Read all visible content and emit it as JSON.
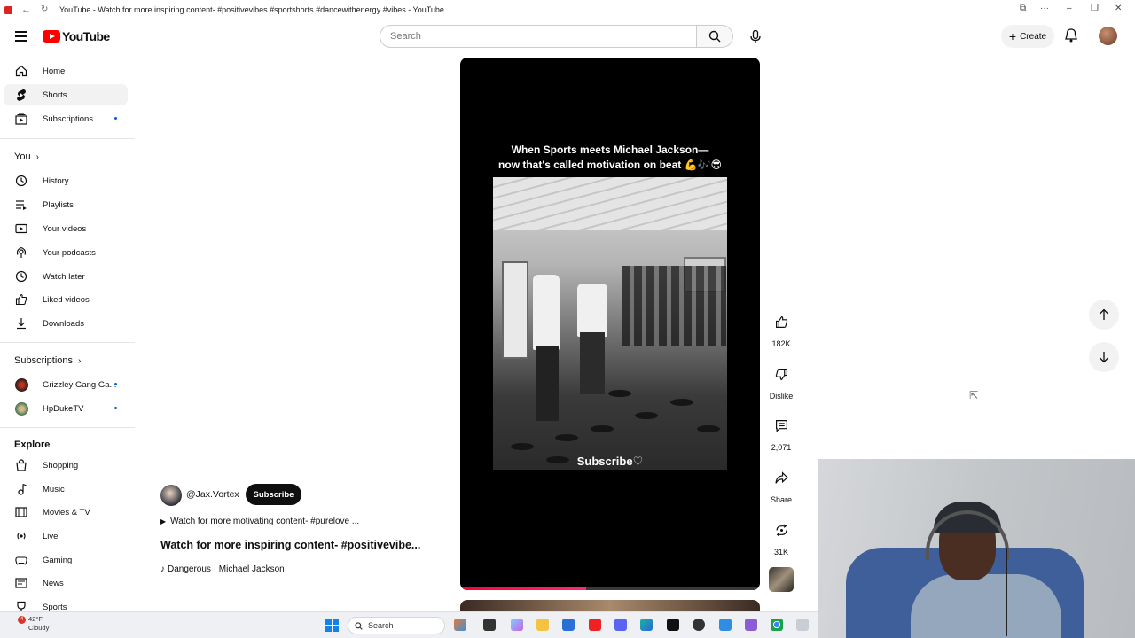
{
  "browser": {
    "title": "YouTube - Watch for more inspiring content- #positivevibes #sportshorts #dancewithenergy #vibes - YouTube"
  },
  "header": {
    "logo_text": "YouTube",
    "search_placeholder": "Search",
    "create_label": "Create"
  },
  "sidebar": {
    "main": [
      {
        "label": "Home",
        "icon": "home-icon"
      },
      {
        "label": "Shorts",
        "icon": "shorts-icon",
        "active": true
      },
      {
        "label": "Subscriptions",
        "icon": "subscriptions-icon"
      }
    ],
    "you_heading": "You",
    "you": [
      {
        "label": "History",
        "icon": "history-icon"
      },
      {
        "label": "Playlists",
        "icon": "playlists-icon"
      },
      {
        "label": "Your videos",
        "icon": "your-videos-icon"
      },
      {
        "label": "Your podcasts",
        "icon": "podcasts-icon"
      },
      {
        "label": "Watch later",
        "icon": "watch-later-icon"
      },
      {
        "label": "Liked videos",
        "icon": "liked-videos-icon"
      },
      {
        "label": "Downloads",
        "icon": "downloads-icon"
      }
    ],
    "subs_heading": "Subscriptions",
    "subs": [
      {
        "label": "Grizzley Gang Ga..."
      },
      {
        "label": "HpDukeTV"
      }
    ],
    "explore_heading": "Explore",
    "explore": [
      {
        "label": "Shopping",
        "icon": "shopping-icon"
      },
      {
        "label": "Music",
        "icon": "music-icon"
      },
      {
        "label": "Movies & TV",
        "icon": "movies-icon"
      },
      {
        "label": "Live",
        "icon": "live-icon"
      },
      {
        "label": "Gaming",
        "icon": "gaming-icon"
      },
      {
        "label": "News",
        "icon": "news-icon"
      },
      {
        "label": "Sports",
        "icon": "sports-icon"
      }
    ]
  },
  "short": {
    "overlay_line1": "When Sports meets Michael Jackson—",
    "overlay_line2": "now that's called motivation on beat 💪🎶😎",
    "subscribe_overlay": "Subscribe♡",
    "progress": 0.42,
    "channel": "@Jax.Vortex",
    "subscribe_label": "Subscribe",
    "description": "Watch for more motivating content- #purelove ...",
    "title": "Watch for more inspiring content- #positivevibe...",
    "music": "Dangerous · Michael Jackson"
  },
  "actions": {
    "likes": "182K",
    "dislike": "Dislike",
    "comments": "2,071",
    "share": "Share",
    "remix": "31K"
  },
  "taskbar": {
    "weather_temp": "42°F",
    "weather_desc": "Cloudy",
    "weather_badge": "4",
    "search_label": "Search"
  }
}
